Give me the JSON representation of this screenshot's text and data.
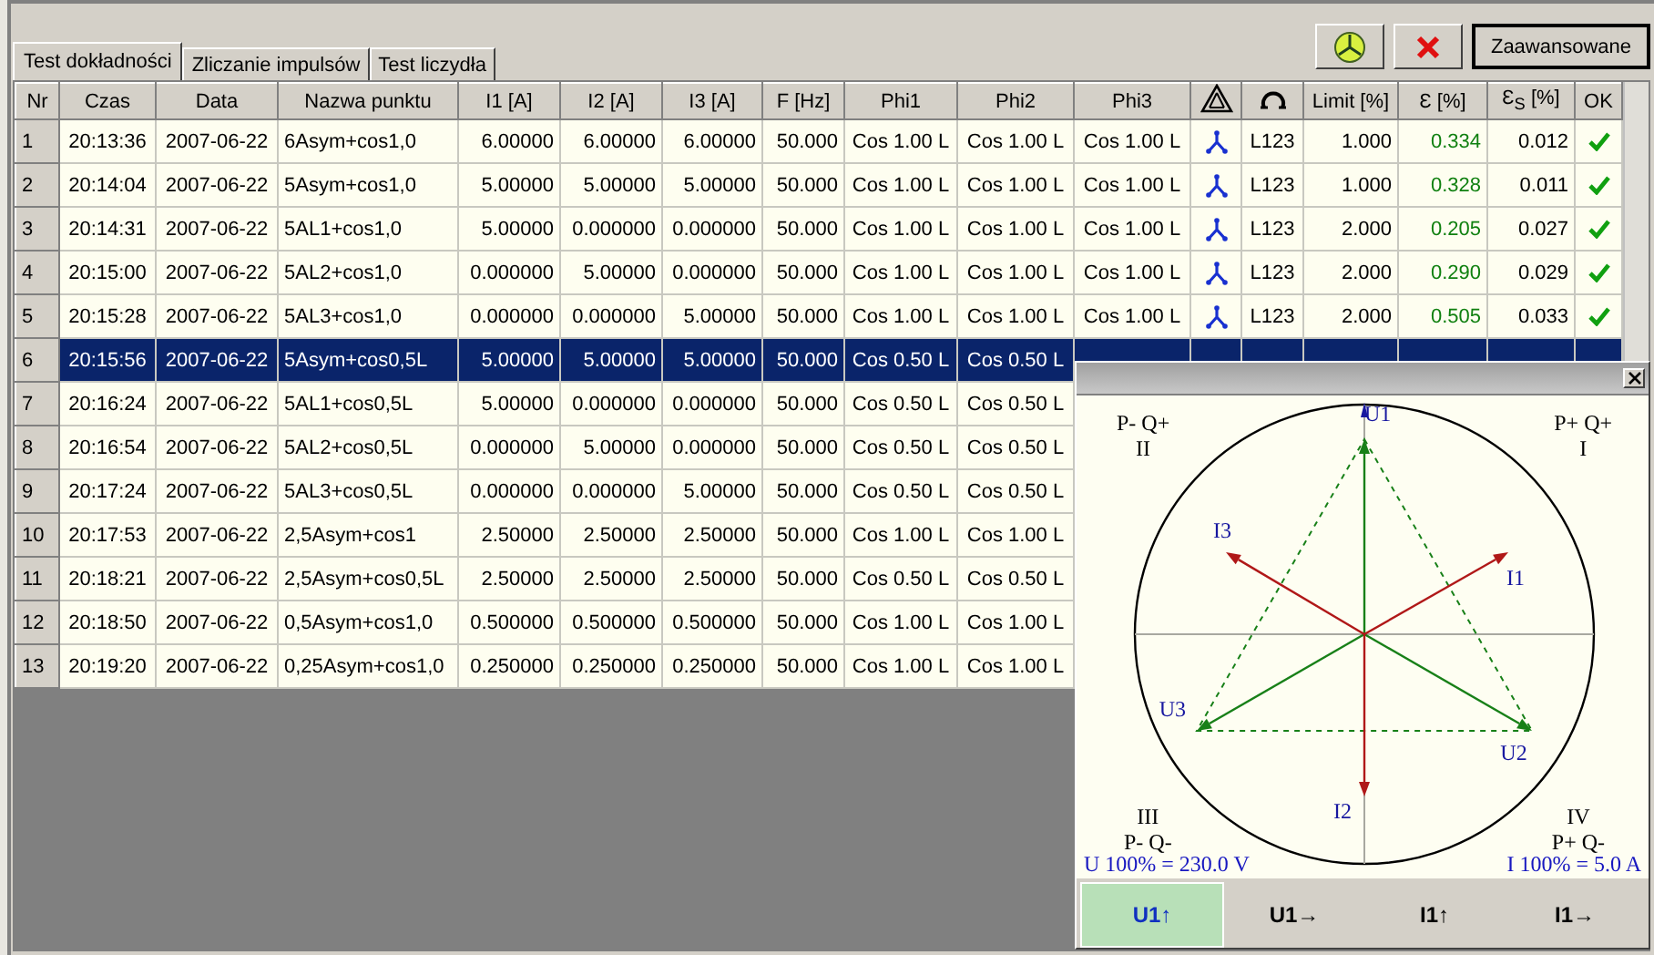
{
  "tabs": [
    {
      "label": "Test dokładności",
      "selected": true
    },
    {
      "label": "Zliczanie impulsów",
      "selected": false
    },
    {
      "label": "Test liczydła",
      "selected": false
    }
  ],
  "toolbar": {
    "advanced_button": "Zaawansowane"
  },
  "table": {
    "columns": [
      {
        "kind": "text",
        "label": "Nr"
      },
      {
        "kind": "text",
        "label": "Czas"
      },
      {
        "kind": "text",
        "label": "Data"
      },
      {
        "kind": "text",
        "label": "Nazwa punktu"
      },
      {
        "kind": "text",
        "label": "I1 [A]"
      },
      {
        "kind": "text",
        "label": "I2 [A]"
      },
      {
        "kind": "text",
        "label": "I3 [A]"
      },
      {
        "kind": "text",
        "label": "F [Hz]"
      },
      {
        "kind": "text",
        "label": "Phi1"
      },
      {
        "kind": "text",
        "label": "Phi2"
      },
      {
        "kind": "text",
        "label": "Phi3"
      },
      {
        "kind": "triangle"
      },
      {
        "kind": "arc"
      },
      {
        "kind": "text",
        "label": "Limit [%]"
      },
      {
        "kind": "text",
        "label": "Ɛ [%]"
      },
      {
        "kind": "text",
        "label": "Ɛ$_{S}$ [%]"
      },
      {
        "kind": "text",
        "label": "OK"
      }
    ],
    "rows": [
      {
        "selected": false,
        "cells": [
          "1",
          "20:13:36",
          "2007-06-22",
          "6Asym+cos1,0",
          "6.00000",
          "6.00000",
          "6.00000",
          "50.000",
          "Cos 1.00 L",
          "Cos 1.00 L",
          "Cos 1.00 L"
        ],
        "kind": "star",
        "tail": [
          "L123",
          "1.000",
          "0.334",
          "0.012"
        ],
        "ok": true
      },
      {
        "selected": false,
        "cells": [
          "2",
          "20:14:04",
          "2007-06-22",
          "5Asym+cos1,0",
          "5.00000",
          "5.00000",
          "5.00000",
          "50.000",
          "Cos 1.00 L",
          "Cos 1.00 L",
          "Cos 1.00 L"
        ],
        "kind": "star",
        "tail": [
          "L123",
          "1.000",
          "0.328",
          "0.011"
        ],
        "ok": true
      },
      {
        "selected": false,
        "cells": [
          "3",
          "20:14:31",
          "2007-06-22",
          "5AL1+cos1,0",
          "5.00000",
          "0.000000",
          "0.000000",
          "50.000",
          "Cos 1.00 L",
          "Cos 1.00 L",
          "Cos 1.00 L"
        ],
        "kind": "star",
        "tail": [
          "L123",
          "2.000",
          "0.205",
          "0.027"
        ],
        "ok": true
      },
      {
        "selected": false,
        "cells": [
          "4",
          "20:15:00",
          "2007-06-22",
          "5AL2+cos1,0",
          "0.000000",
          "5.00000",
          "0.000000",
          "50.000",
          "Cos 1.00 L",
          "Cos 1.00 L",
          "Cos 1.00 L"
        ],
        "kind": "star",
        "tail": [
          "L123",
          "2.000",
          "0.290",
          "0.029"
        ],
        "ok": true
      },
      {
        "selected": false,
        "cells": [
          "5",
          "20:15:28",
          "2007-06-22",
          "5AL3+cos1,0",
          "0.000000",
          "0.000000",
          "5.00000",
          "50.000",
          "Cos 1.00 L",
          "Cos 1.00 L",
          "Cos 1.00 L"
        ],
        "kind": "star",
        "tail": [
          "L123",
          "2.000",
          "0.505",
          "0.033"
        ],
        "ok": true
      },
      {
        "selected": true,
        "cells": [
          "6",
          "20:15:56",
          "2007-06-22",
          "5Asym+cos0,5L",
          "5.00000",
          "5.00000",
          "5.00000",
          "50.000",
          "Cos 0.50 L",
          "Cos 0.50 L"
        ]
      },
      {
        "selected": false,
        "cells": [
          "7",
          "20:16:24",
          "2007-06-22",
          "5AL1+cos0,5L",
          "5.00000",
          "0.000000",
          "0.000000",
          "50.000",
          "Cos 0.50 L",
          "Cos 0.50 L"
        ]
      },
      {
        "selected": false,
        "cells": [
          "8",
          "20:16:54",
          "2007-06-22",
          "5AL2+cos0,5L",
          "0.000000",
          "5.00000",
          "0.000000",
          "50.000",
          "Cos 0.50 L",
          "Cos 0.50 L"
        ]
      },
      {
        "selected": false,
        "cells": [
          "9",
          "20:17:24",
          "2007-06-22",
          "5AL3+cos0,5L",
          "0.000000",
          "0.000000",
          "5.00000",
          "50.000",
          "Cos 0.50 L",
          "Cos 0.50 L"
        ]
      },
      {
        "selected": false,
        "cells": [
          "10",
          "20:17:53",
          "2007-06-22",
          "2,5Asym+cos1",
          "2.50000",
          "2.50000",
          "2.50000",
          "50.000",
          "Cos 1.00 L",
          "Cos 1.00 L"
        ]
      },
      {
        "selected": false,
        "cells": [
          "11",
          "20:18:21",
          "2007-06-22",
          "2,5Asym+cos0,5L",
          "2.50000",
          "2.50000",
          "2.50000",
          "50.000",
          "Cos 0.50 L",
          "Cos 0.50 L"
        ]
      },
      {
        "selected": false,
        "cells": [
          "12",
          "20:18:50",
          "2007-06-22",
          "0,5Asym+cos1,0",
          "0.500000",
          "0.500000",
          "0.500000",
          "50.000",
          "Cos 1.00 L",
          "Cos 1.00 L"
        ]
      },
      {
        "selected": false,
        "cells": [
          "13",
          "20:19:20",
          "2007-06-22",
          "0,25Asym+cos1,0",
          "0.250000",
          "0.250000",
          "0.250000",
          "50.000",
          "Cos 1.00 L",
          "Cos 1.00 L"
        ]
      }
    ]
  },
  "phasor_window": {
    "quadrants": [
      {
        "power": "P- Q+",
        "roman": "II"
      },
      {
        "power": "P+ Q+",
        "roman": "I"
      },
      {
        "roman": "III",
        "power": "P- Q-"
      },
      {
        "roman": "IV",
        "power": "P+ Q-"
      }
    ],
    "vectors": [
      {
        "label": "U1",
        "kind": "voltage"
      },
      {
        "label": "U2",
        "kind": "voltage"
      },
      {
        "label": "U3",
        "kind": "voltage"
      },
      {
        "label": "I1",
        "kind": "current"
      },
      {
        "label": "I2",
        "kind": "current"
      },
      {
        "label": "I3",
        "kind": "current"
      }
    ],
    "voltage_scale": "U 100% = 230.0 V",
    "current_scale": "I 100% = 5.0 A",
    "modes": [
      {
        "label": "U1↑",
        "selected": true
      },
      {
        "label": "U1→",
        "selected": false
      },
      {
        "label": "I1↑",
        "selected": false
      },
      {
        "label": "I1→",
        "selected": false
      }
    ]
  }
}
